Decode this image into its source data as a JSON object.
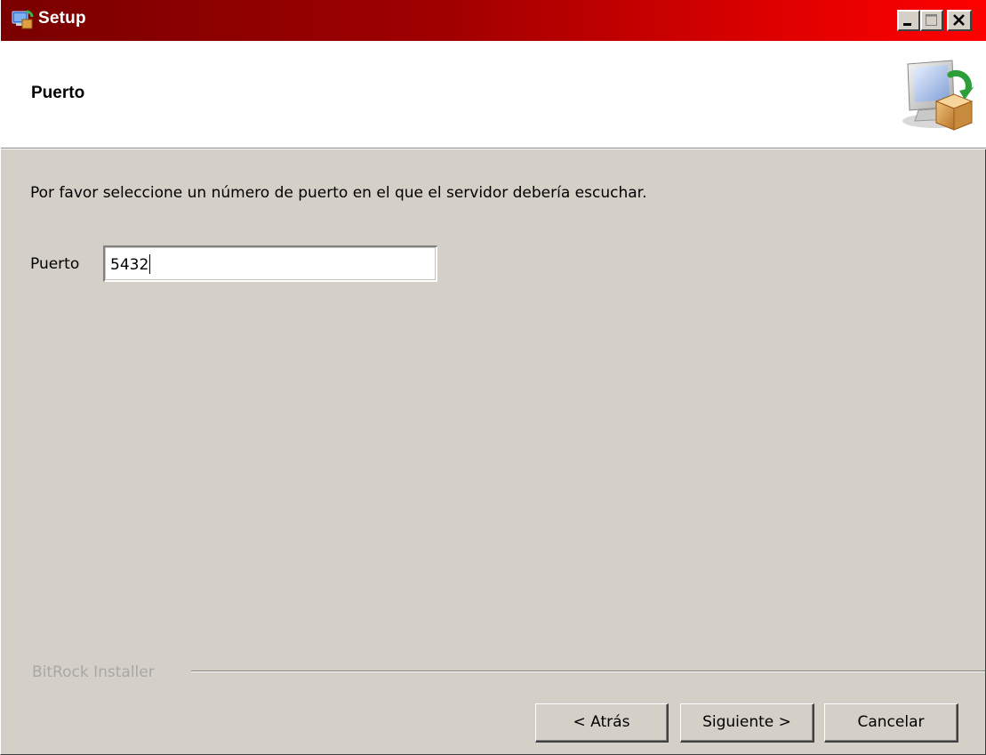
{
  "window": {
    "title": "Setup",
    "icons": {
      "app": "setup-installer-icon",
      "minimize": "minimize-icon",
      "maximize": "maximize-icon",
      "close": "close-icon"
    }
  },
  "header": {
    "title": "Puerto",
    "icon": "computer-package-icon"
  },
  "content": {
    "instruction": "Por favor seleccione un número de puerto en el que el servidor debería escuchar.",
    "port_label": "Puerto",
    "port_value": "5432"
  },
  "footer": {
    "brand": "BitRock Installer",
    "buttons": {
      "back": "< Atrás",
      "next": "Siguiente >",
      "cancel": "Cancelar"
    }
  },
  "colors": {
    "titlebar_start": "#7a0000",
    "titlebar_end": "#ff0000",
    "dialog_bg": "#d4d0c8",
    "header_bg": "#ffffff",
    "brand_text": "#a7a7a7"
  }
}
